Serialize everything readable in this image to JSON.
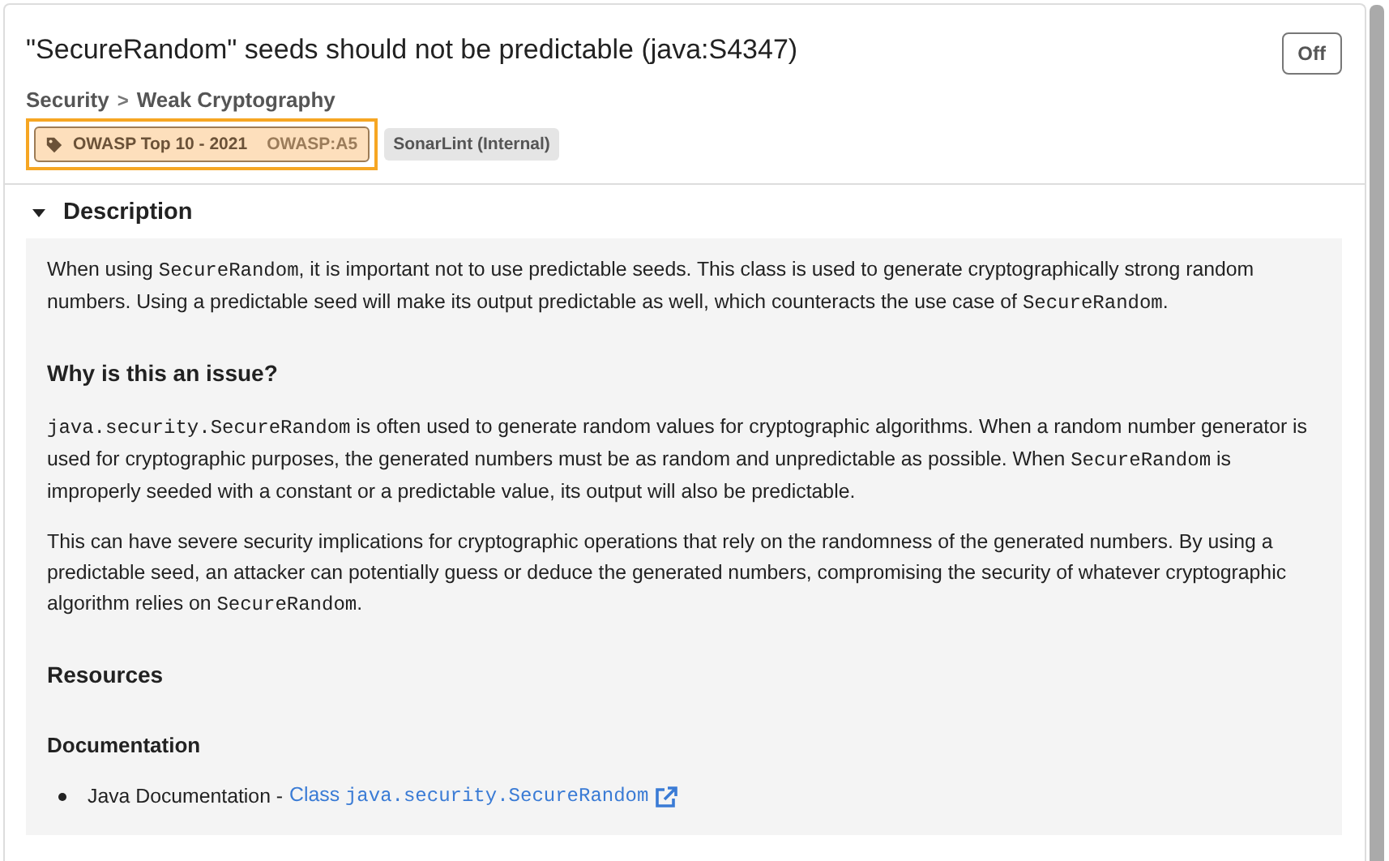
{
  "rule": {
    "title": "\"SecureRandom\" seeds should not be predictable (java:S4347)",
    "toggle": {
      "label": "Off"
    },
    "breadcrumb": [
      "Security",
      "Weak Cryptography"
    ],
    "separator": ">",
    "tags": [
      {
        "kind": "standard",
        "label": "OWASP Top 10 - 2021",
        "code": "OWASP:A5",
        "selected": true
      },
      {
        "kind": "plain",
        "label": "SonarLint (Internal)",
        "selected": false
      }
    ]
  },
  "description": {
    "heading": "Description",
    "expanded": true,
    "blocks": [
      {
        "kind": "para",
        "parts": [
          {
            "t": "When using ",
            "code": false
          },
          {
            "t": "SecureRandom",
            "code": true
          },
          {
            "t": ", it is important not to use predictable seeds. This class is used to generate cryptographically strong random numbers. Using a predictable seed will make its output predictable as well, which counteracts the use case of ",
            "code": false
          },
          {
            "t": "SecureRandom",
            "code": true
          },
          {
            "t": ".",
            "code": false
          }
        ]
      },
      {
        "kind": "h2",
        "text": "Why is this an issue?"
      },
      {
        "kind": "para",
        "parts": [
          {
            "t": "java.security.SecureRandom",
            "code": true
          },
          {
            "t": " is often used to generate random values for cryptographic algorithms. When a random number generator is used for cryptographic purposes, the generated numbers must be as random and unpredictable as possible. When ",
            "code": false
          },
          {
            "t": "SecureRandom",
            "code": true
          },
          {
            "t": " is improperly seeded with a constant or a predictable value, its output will also be predictable.",
            "code": false
          }
        ]
      },
      {
        "kind": "para",
        "parts": [
          {
            "t": "This can have severe security implications for cryptographic operations that rely on the randomness of the generated numbers. By using a predictable seed, an attacker can potentially guess or deduce the generated numbers, compromising the security of whatever cryptographic algorithm relies on ",
            "code": false
          },
          {
            "t": "SecureRandom",
            "code": true
          },
          {
            "t": ".",
            "code": false
          }
        ]
      },
      {
        "kind": "h2",
        "text": "Resources"
      },
      {
        "kind": "h3",
        "text": "Documentation"
      },
      {
        "kind": "bullet",
        "text": "Java Documentation - ",
        "link": "Class",
        "link_code": "java.security.SecureRandom"
      }
    ]
  }
}
